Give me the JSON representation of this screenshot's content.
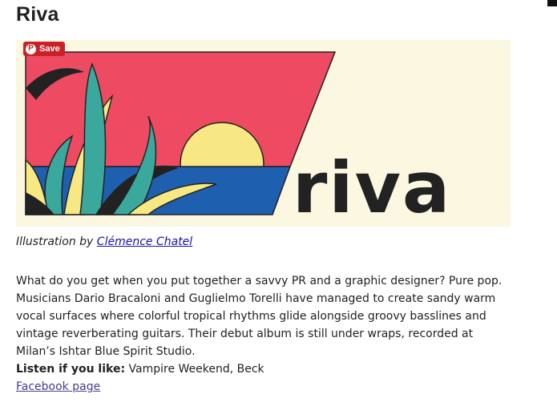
{
  "page": {
    "title": "Riva"
  },
  "image": {
    "save_label": "Save",
    "pin_icon": "pinterest-icon",
    "logo_text": "riva",
    "colors": {
      "background": "#fbf7e1",
      "pink": "#ee4b63",
      "blue": "#1f5fb0",
      "sun": "#f7e884",
      "teal": "#3aa89c",
      "dark": "#222222"
    }
  },
  "caption": {
    "prefix": "Illustration by ",
    "credit_link": "Clémence Chatel"
  },
  "body": {
    "paragraph": "What do you get when you put together a savvy PR and a graphic designer? Pure pop. Musicians Dario Bracaloni and Guglielmo Torelli have managed to create sandy warm vocal surfaces where colorful tropical rhythms glide alongside groovy basslines and vintage reverberating guitars. Their debut album is still under wraps, recorded at Milan’s Ishtar Blue Spirit Studio.",
    "listen_label": "Listen if you like:",
    "listen_value": " Vampire Weekend, Beck",
    "facebook_link": "Facebook page"
  }
}
